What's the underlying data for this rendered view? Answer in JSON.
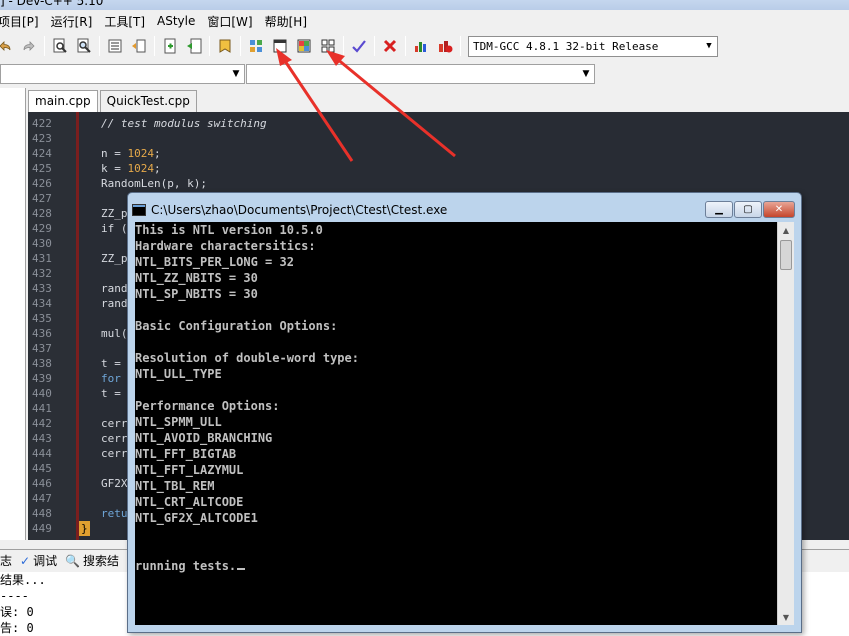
{
  "window": {
    "title": "] - Dev-C++ 5.10"
  },
  "menu": [
    "项目[P]",
    "运行[R]",
    "工具[T]",
    "AStyle",
    "窗口[W]",
    "帮助[H]"
  ],
  "toolbar": {
    "compiler_label": "TDM-GCC 4.8.1 32-bit Release",
    "icons": [
      "undo-icon",
      "redo-icon",
      "find-icon",
      "replace-icon",
      "indent-icon",
      "unindent-icon",
      "add-file-icon",
      "remove-file-icon",
      "bookmark-icon",
      "layout-grid-icon",
      "window-icon",
      "color-grid-icon",
      "tile-icon",
      "check-icon",
      "delete-icon",
      "chart-icon",
      "chart-alert-icon"
    ]
  },
  "tabs": [
    "main.cpp",
    "QuickTest.cpp"
  ],
  "editor": {
    "lines": [
      {
        "n": "422",
        "code": "// test modulus switching",
        "type": "comment"
      },
      {
        "n": "423",
        "code": ""
      },
      {
        "n": "424",
        "code": "n = 1024;",
        "num": "1024",
        "pre": "n = ",
        "post": ";"
      },
      {
        "n": "425",
        "code": "k = 1024;",
        "num": "1024",
        "pre": "k = ",
        "post": ";"
      },
      {
        "n": "426",
        "code": "RandomLen(p, k);"
      },
      {
        "n": "427",
        "code": ""
      },
      {
        "n": "428",
        "code": "ZZ_p"
      },
      {
        "n": "429",
        "code": "if ("
      },
      {
        "n": "430",
        "code": ""
      },
      {
        "n": "431",
        "code": "ZZ_p"
      },
      {
        "n": "432",
        "code": ""
      },
      {
        "n": "433",
        "code": "rand"
      },
      {
        "n": "434",
        "code": "rand"
      },
      {
        "n": "435",
        "code": ""
      },
      {
        "n": "436",
        "code": "mul("
      },
      {
        "n": "437",
        "code": ""
      },
      {
        "n": "438",
        "code": "t ="
      },
      {
        "n": "439",
        "code": "for",
        "type": "keyword"
      },
      {
        "n": "440",
        "code": "t ="
      },
      {
        "n": "441",
        "code": ""
      },
      {
        "n": "442",
        "code": "cerr"
      },
      {
        "n": "443",
        "code": "cerr"
      },
      {
        "n": "444",
        "code": "cerr"
      },
      {
        "n": "445",
        "code": ""
      },
      {
        "n": "446",
        "code": "GF2X"
      },
      {
        "n": "447",
        "code": ""
      },
      {
        "n": "448",
        "code": "retu",
        "type": "keyword"
      },
      {
        "n": "449",
        "code": "}",
        "type": "brace"
      }
    ]
  },
  "bottom": {
    "tabs": [
      "志",
      "调试",
      "搜索结"
    ],
    "output": [
      "结果...",
      "----",
      "误: 0",
      "告: 0"
    ]
  },
  "console": {
    "title": "C:\\Users\\zhao\\Documents\\Project\\Ctest\\Ctest.exe",
    "lines": [
      "This is NTL version 10.5.0",
      "Hardware charactersitics:",
      "NTL_BITS_PER_LONG = 32",
      "NTL_ZZ_NBITS = 30",
      "NTL_SP_NBITS = 30",
      "",
      "Basic Configuration Options:",
      "",
      "Resolution of double-word type:",
      "NTL_ULL_TYPE",
      "",
      "Performance Options:",
      "NTL_SPMM_ULL",
      "NTL_AVOID_BRANCHING",
      "NTL_FFT_BIGTAB",
      "NTL_FFT_LAZYMUL",
      "NTL_TBL_REM",
      "NTL_CRT_ALTCODE",
      "NTL_GF2X_ALTCODE1",
      "",
      "",
      "running tests."
    ]
  },
  "colors": {
    "editor_bg": "#282c34",
    "arrow": "#e8312a",
    "console_bg": "#000000",
    "console_text": "#c0c0c0"
  }
}
